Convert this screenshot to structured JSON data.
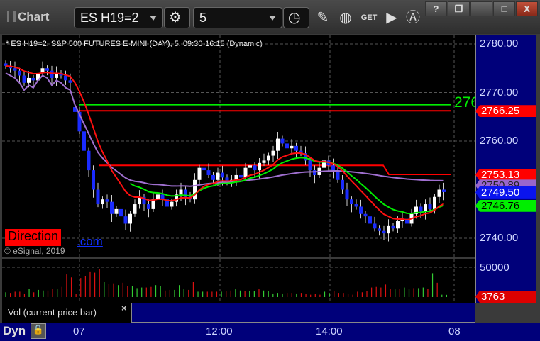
{
  "toolbar": {
    "title": "Chart",
    "symbol": "ES H19=2",
    "interval": "5",
    "help": "?",
    "close": "X"
  },
  "legend": "* ES H19=2, S&P 500 FUTURES E-MINI (DAY), 5, 09:30-16:15 (Dynamic)",
  "watermark": {
    "brand": "Direction",
    "suffix": ".com",
    "copyright": "© eSignal, 2019"
  },
  "price_axis": {
    "labels": [
      {
        "v": 2780,
        "t": "2780.00"
      },
      {
        "v": 2770,
        "t": "2770.00"
      },
      {
        "v": 2760,
        "t": "2760.00"
      },
      {
        "v": 2740,
        "t": "2740.00"
      }
    ],
    "tags": [
      {
        "v": 2766.25,
        "t": "2766.25",
        "bg": "#ff0000",
        "fg": "#ffffff"
      },
      {
        "v": 2753.13,
        "t": "2753.13",
        "bg": "#ff0000",
        "fg": "#ffffff"
      },
      {
        "v": 2750.89,
        "t": "2750.89",
        "bg": "#9966cc",
        "fg": "#222222"
      },
      {
        "v": 2749.5,
        "t": "2749.50",
        "bg": "#0a14ee",
        "fg": "#ffffff"
      },
      {
        "v": 2746.76,
        "t": "2746.76",
        "bg": "#00ee00",
        "fg": "#000000"
      }
    ]
  },
  "level_label": "276",
  "levels": {
    "green": 2767.5,
    "red": 2766.25
  },
  "closes": [
    2775.5,
    2775,
    2774.5,
    2773.5,
    2772,
    2773,
    2772.5,
    2774,
    2775,
    2774.5,
    2773,
    2774,
    2773.5,
    2772.5,
    2772,
    2766,
    2762,
    2758,
    2754,
    2750,
    2747,
    2748,
    2747.5,
    2745,
    2746,
    2744.5,
    2743,
    2745,
    2747,
    2748.5,
    2747,
    2746,
    2748,
    2749,
    2748,
    2746.5,
    2747.5,
    2749,
    2750,
    2748.5,
    2748,
    2752,
    2754.5,
    2754,
    2753,
    2752,
    2753.5,
    2752.5,
    2751.5,
    2752,
    2753,
    2752.5,
    2754.5,
    2755,
    2754,
    2755.5,
    2756,
    2757,
    2758,
    2760.5,
    2759.5,
    2758.5,
    2759,
    2758,
    2757.5,
    2756,
    2754,
    2753,
    2754.5,
    2756,
    2755,
    2754,
    2752,
    2750,
    2748,
    2747,
    2746.5,
    2745,
    2744.5,
    2743,
    2742,
    2741.5,
    2741,
    2742.5,
    2742,
    2743.5,
    2744,
    2743,
    2745,
    2746.5,
    2745.5,
    2747,
    2746,
    2748.5,
    2750,
    2749.5
  ],
  "volume": {
    "top_label": "50000",
    "current": "3763",
    "title": "Vol (current price bar)",
    "close": "×",
    "values": [
      8000,
      7000,
      9000,
      9000,
      6000,
      14000,
      8000,
      12000,
      11000,
      11000,
      14000,
      13000,
      17000,
      38000,
      33000,
      5000,
      32000,
      35000,
      43000,
      41000,
      47000,
      25000,
      22000,
      23000,
      20000,
      24000,
      19000,
      18000,
      15000,
      16000,
      16000,
      17000,
      20000,
      19000,
      11000,
      12000,
      12000,
      20000,
      13000,
      12000,
      25000,
      9000,
      9000,
      9000,
      9000,
      9000,
      9000,
      10000,
      11000,
      13000,
      11000,
      10000,
      10000,
      10000,
      13000,
      11000,
      10000,
      6000,
      7000,
      6000,
      7000,
      7000,
      6000,
      7000,
      5000,
      4000,
      5000,
      4000,
      9000,
      7000,
      10000,
      7000,
      7000,
      6000,
      4000,
      9000,
      8000,
      10000,
      16000,
      17000,
      16000,
      21000,
      14000,
      13000,
      14000,
      16000,
      13000,
      15000,
      15000,
      16000,
      14000,
      40000,
      24000,
      4000,
      3763
    ]
  },
  "time_axis": {
    "mode": "Dyn",
    "labels": [
      "07",
      "12:00",
      "14:00",
      "08"
    ]
  }
}
